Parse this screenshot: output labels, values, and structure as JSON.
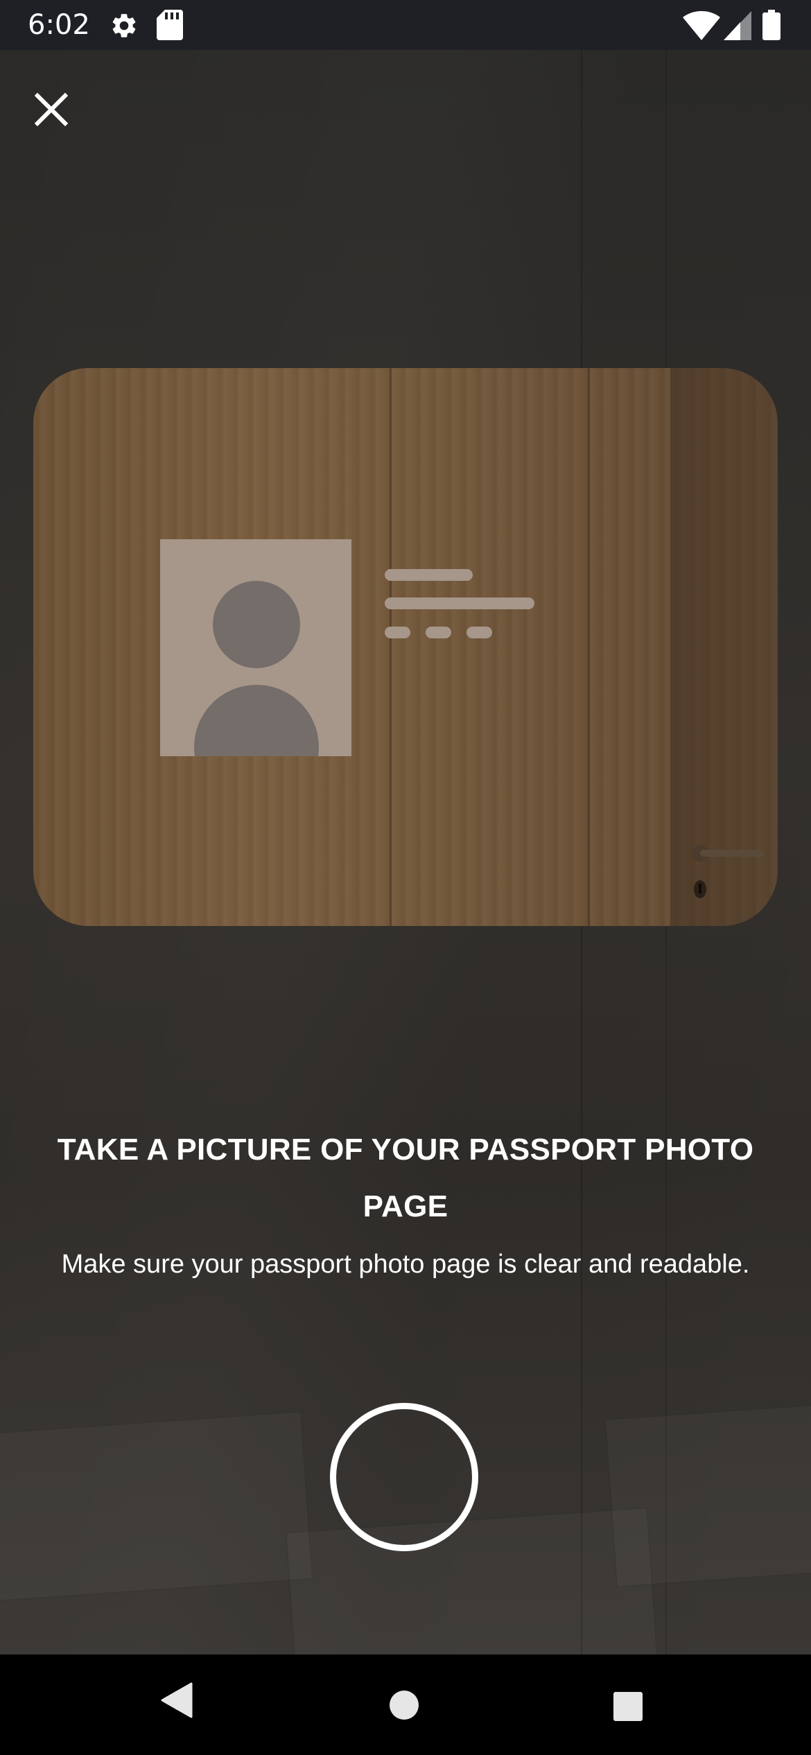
{
  "status_bar": {
    "time": "6:02",
    "icons_left": [
      "settings-icon",
      "sd-card-icon"
    ],
    "icons_right": [
      "wifi-icon",
      "cell-signal-icon",
      "battery-icon"
    ]
  },
  "camera": {
    "close_icon": "close-icon"
  },
  "instructions": {
    "title": "TAKE A PICTURE OF YOUR PASSPORT PHOTO PAGE",
    "subtitle": "Make sure your passport photo page is clear and readable."
  },
  "nav_bar": {
    "buttons": [
      "back-icon",
      "home-icon",
      "recents-icon"
    ]
  },
  "colors": {
    "status_bar": "#1f2025",
    "placeholder": "#a7978a",
    "avatar": "#756d6a",
    "text": "#ffffff"
  }
}
